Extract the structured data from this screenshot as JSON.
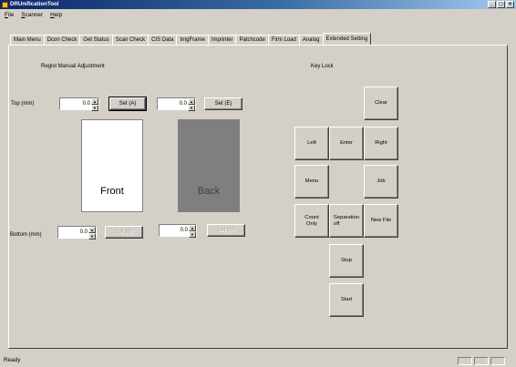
{
  "window": {
    "title": "DRUnificationTool",
    "controls": [
      "_",
      "□",
      "×"
    ]
  },
  "menu": [
    "File",
    "Scanner",
    "Help"
  ],
  "tabs": [
    {
      "label": "Main Menu"
    },
    {
      "label": "Dcon Check"
    },
    {
      "label": "Get Status"
    },
    {
      "label": "Scan Check"
    },
    {
      "label": "CIS Data"
    },
    {
      "label": "ImgFrame"
    },
    {
      "label": "Imprinter"
    },
    {
      "label": "Patchcode"
    },
    {
      "label": "Firm Load"
    },
    {
      "label": "Analog"
    },
    {
      "label": "Extended Setting",
      "active": true
    }
  ],
  "regist": {
    "section_label": "Regist Manual Adjustment",
    "top_label": "Top (mm)",
    "bottom_label": "Bottom (mm)",
    "top_a_value": "0.0",
    "top_e_value": "0.0",
    "bottom_b_value": "0.0",
    "bottom_g_value": "0.0",
    "set_a": "Set (A)",
    "set_e": "Set (E)",
    "set_b": "Set (B)",
    "set_g": "Set (G)",
    "front_label": "Front",
    "back_label": "Back",
    "front_color": "#ffffff",
    "back_color": "#7f7f7f"
  },
  "keylock": {
    "section_label": "Key Lock",
    "clear": "Clear",
    "left": "Left",
    "enter": "Enter",
    "right": "Right",
    "menu": "Menu",
    "job": "Job",
    "count_only": "Count\nOnly",
    "separation_off": "Separation\noff",
    "new_file": "New File",
    "stop": "Stop",
    "start": "Start"
  },
  "status": {
    "text": "Ready"
  }
}
